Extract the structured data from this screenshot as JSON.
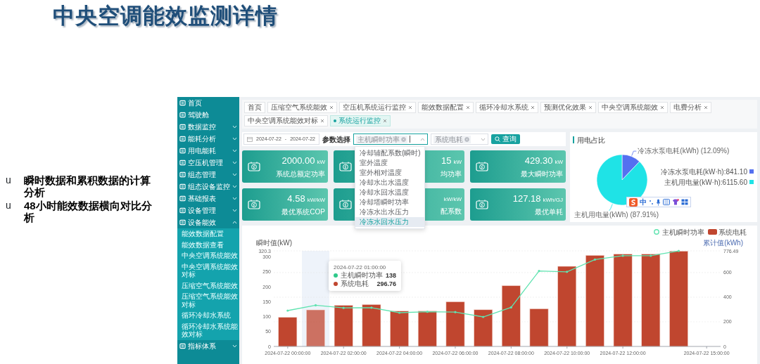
{
  "slide": {
    "title": "中央空调能效监测详情",
    "bullets": [
      {
        "marker": "u",
        "text": "瞬时数据和累积数据的计算分析"
      },
      {
        "marker": "u",
        "text": "48小时能效数据横向对比分析"
      }
    ]
  },
  "sidebar": {
    "items": [
      {
        "label": "首页",
        "kind": "link"
      },
      {
        "label": "驾驶舱",
        "kind": "link"
      },
      {
        "label": "数据监控",
        "kind": "group",
        "expanded": false
      },
      {
        "label": "能耗分析",
        "kind": "group",
        "expanded": false
      },
      {
        "label": "用电能耗",
        "kind": "group",
        "expanded": false
      },
      {
        "label": "空压机管理",
        "kind": "group",
        "expanded": false
      },
      {
        "label": "组态管理",
        "kind": "group",
        "expanded": false
      },
      {
        "label": "组态设备监控",
        "kind": "group",
        "expanded": false
      },
      {
        "label": "基础报表",
        "kind": "group",
        "expanded": false
      },
      {
        "label": "设备管理",
        "kind": "group",
        "expanded": false
      },
      {
        "label": "设备能效",
        "kind": "group",
        "expanded": true,
        "children": [
          {
            "label": "能效数据配置"
          },
          {
            "label": "能效数据查看"
          },
          {
            "label": "中央空调系统能效"
          },
          {
            "label": "中央空调系统能效对标"
          },
          {
            "label": "压缩空气系统能效"
          },
          {
            "label": "压缩空气系统能效对标"
          },
          {
            "label": "循环冷却水系统"
          },
          {
            "label": "循环冷却水系统能效对标"
          }
        ]
      },
      {
        "label": "指标体系",
        "kind": "group",
        "expanded": false
      }
    ]
  },
  "tabs": [
    {
      "label": "首页",
      "selected": false,
      "closable": false
    },
    {
      "label": "压缩空气系统能效",
      "selected": false,
      "closable": true
    },
    {
      "label": "空压机系统运行监控",
      "selected": false,
      "closable": true
    },
    {
      "label": "能效数据配置",
      "selected": false,
      "closable": true
    },
    {
      "label": "循环冷却水系统",
      "selected": false,
      "closable": true
    },
    {
      "label": "预测优化效果",
      "selected": false,
      "closable": true
    },
    {
      "label": "中央空调系统能效",
      "selected": false,
      "closable": true
    },
    {
      "label": "电费分析",
      "selected": false,
      "closable": true
    },
    {
      "label": "中央空调系统能效对标",
      "selected": false,
      "closable": true
    },
    {
      "label": "系统运行监控",
      "selected": true,
      "closable": true
    }
  ],
  "filters": {
    "date_range": {
      "start": "2024-07-22",
      "separator": "-",
      "end": "2024-07-22"
    },
    "param_label": "参数选择",
    "selects": [
      {
        "tags": [
          "主机瞬时功率"
        ],
        "expanded": true
      },
      {
        "tags": [
          "系统电耗"
        ],
        "expanded": false
      }
    ],
    "query_button": "查询"
  },
  "dropdown": {
    "options": [
      {
        "label": "冷却辅配系数(瞬时)",
        "highlighted": false
      },
      {
        "label": "室外温度",
        "highlighted": false
      },
      {
        "label": "室外相对温度",
        "highlighted": false
      },
      {
        "label": "冷却水出水温度",
        "highlighted": false
      },
      {
        "label": "冷却水回水温度",
        "highlighted": false
      },
      {
        "label": "冷却塔瞬时功率",
        "highlighted": false
      },
      {
        "label": "冷冻水出水压力",
        "highlighted": false
      },
      {
        "label": "冷冻水回水压力",
        "highlighted": true
      }
    ]
  },
  "metric_cards": [
    {
      "value": "2000.00",
      "unit": "kW",
      "label": "系统总额定功率"
    },
    {
      "value": "15",
      "unit": "kW",
      "label": "均功率"
    },
    {
      "value": "429.30",
      "unit": "kW",
      "label": "最大瞬时功率"
    },
    {
      "value": "4.58",
      "unit": "kW/kW",
      "label": "最优系统COP"
    },
    {
      "unit": "kW/kW",
      "label": "配系数"
    },
    {
      "value": "127.18",
      "unit": "kWh/GJ",
      "label": "最优单耗"
    }
  ],
  "power_share": {
    "title": "用电占比",
    "chart_data": {
      "type": "pie",
      "values": [
        12.09,
        87.91
      ],
      "value_labels": [
        "冷冻水泵电耗(kWh) (12.09%)",
        "主机用电量(kWh) (87.91%)"
      ]
    },
    "legend": [
      {
        "text": "冷冻水泵电耗(kW·h):841.10",
        "color": "#5470f0"
      },
      {
        "text": "主机用电量(kW·h):6115.60",
        "color": "#1fe3e6"
      }
    ]
  },
  "ime_toolbar": {
    "text": "中"
  },
  "trend_chart": {
    "bar_chart": {
      "chart_data": {
        "type": "bar",
        "categories": [
          "2024-07-22 00:00:00",
          null,
          "2024-07-22 02:00:00",
          null,
          "2024-07-22 04:00:00",
          null,
          "2024-07-22 06:00:00",
          null,
          "2024-07-22 08:00:00",
          null,
          "2024-07-22 10:00:00",
          null,
          "2024-07-22 12:00:00",
          null,
          null,
          "2024-07-22 15:00:00"
        ],
        "series": [
          {
            "name": "系统电耗",
            "color": "#c0462f",
            "values": [
              237,
              297,
              334,
              341,
              287,
              287,
              363,
              298,
              494,
              306,
              651,
              740,
              750,
              750,
              774,
              null
            ]
          }
        ],
        "ylabel": "累计值(kWh)",
        "ylim": [
          0,
          776.49
        ],
        "yticks": [
          0,
          200,
          400,
          600,
          776.49
        ],
        "grid": true
      }
    },
    "hover_slots": [
      {
        "hovered": false
      },
      {
        "hovered": true
      },
      {
        "hovered": false
      },
      {
        "hovered": false
      },
      {
        "hovered": false
      },
      {
        "hovered": false
      },
      {
        "hovered": false
      },
      {
        "hovered": false
      },
      {
        "hovered": false
      },
      {
        "hovered": false
      },
      {
        "hovered": false
      },
      {
        "hovered": false
      },
      {
        "hovered": false
      },
      {
        "hovered": false
      },
      {
        "hovered": false
      }
    ],
    "line_chart": {
      "chart_data": {
        "type": "line",
        "categories": [
          null,
          null,
          null,
          null,
          null,
          null,
          null,
          null,
          null,
          null,
          null,
          null,
          null,
          null,
          null,
          null
        ],
        "series": [
          {
            "name": "主机瞬时功率",
            "color": "#5fe3b0",
            "values": [
              120,
              138,
              129,
              130,
              113,
              116,
              115,
              99,
              131,
              253,
              250,
              291,
              304,
              304,
              320,
              null
            ]
          }
        ],
        "ylabel": "瞬时值(kW)",
        "ylim": [
          0,
          320.3
        ],
        "yticks": [
          0,
          50,
          100,
          150,
          200,
          250,
          300,
          320.3
        ]
      }
    },
    "tooltip": {
      "title": "2024-07-22 01:00:00",
      "rows": [
        {
          "name": "主机瞬时功率",
          "value": "138",
          "color": "#2fc98a"
        },
        {
          "name": "系统电耗",
          "value": "296.76",
          "color": "#c0462f"
        }
      ]
    }
  }
}
